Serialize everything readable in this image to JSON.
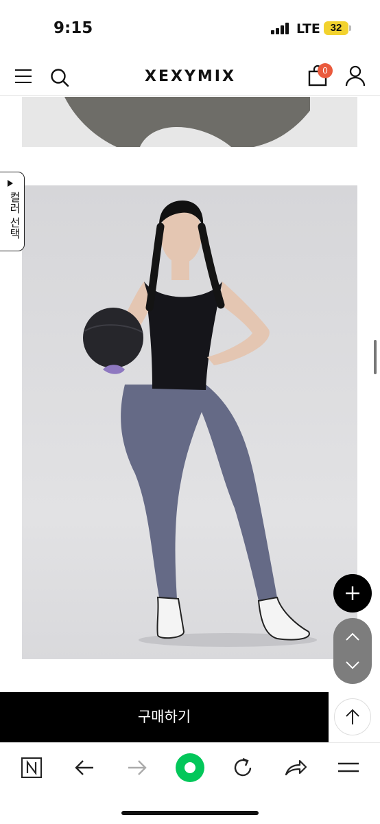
{
  "status_bar": {
    "time": "9:15",
    "network": "LTE",
    "battery": "32"
  },
  "header": {
    "logo": "XEXYMIX",
    "cart_count": "0"
  },
  "side_tab": {
    "label": "컬러 선택"
  },
  "purchase": {
    "button_label": "구매하기"
  },
  "colors": {
    "accent_badge": "#ea5a3d",
    "battery": "#f2d22e",
    "naver_green": "#03c75a"
  },
  "icons": {
    "menu": "hamburger-icon",
    "search": "search-icon",
    "cart": "shopping-bag-icon",
    "account": "user-icon",
    "plus": "plus-icon",
    "up": "chevron-up-icon",
    "down": "chevron-down-icon",
    "top": "arrow-up-icon",
    "naver": "naver-n-icon",
    "back": "arrow-left-icon",
    "forward": "arrow-right-icon",
    "green": "green-dot-icon",
    "refresh": "refresh-icon",
    "share": "share-icon",
    "more": "menu-icon"
  }
}
